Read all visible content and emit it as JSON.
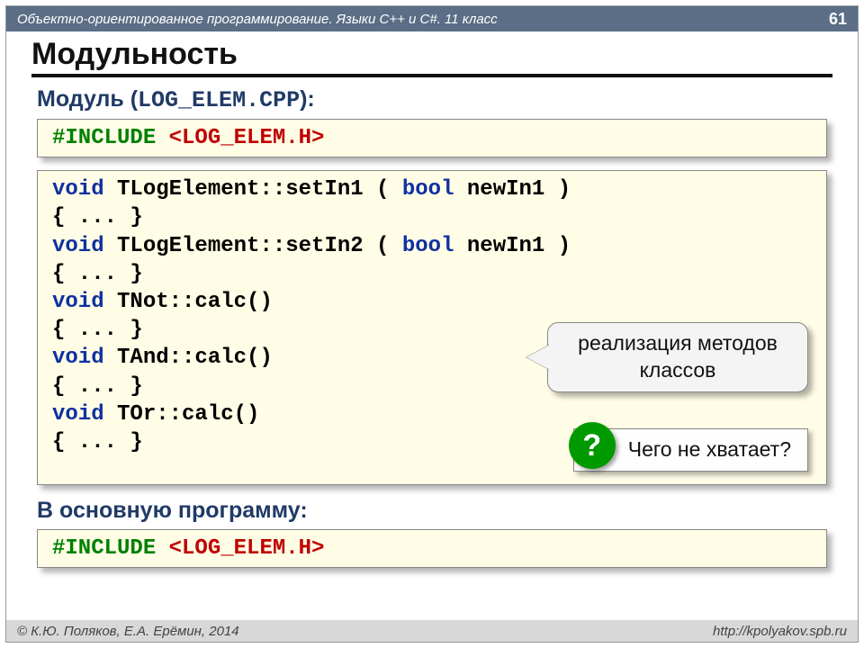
{
  "header": {
    "course": "Объектно-ориентированное программирование. Языки C++ и C#. 11 класс",
    "page": "61"
  },
  "title": "Модульность",
  "module": {
    "label": "Модуль",
    "filename": "LOG_ELEM.CPP",
    "suffix": ":"
  },
  "include1": {
    "directive": "#INCLUDE",
    "file": "<LOG_ELEM.H>"
  },
  "code": {
    "l1a": "void",
    "l1b": " TLogElement::setIn1 ( ",
    "l1c": "bool",
    "l1d": " newIn1 )",
    "l2": "{ ... }",
    "l3a": "void",
    "l3b": " TLogElement::setIn2 ( ",
    "l3c": "bool",
    "l3d": " newIn1 )",
    "l4": "{ ... }",
    "l5a": "void",
    "l5b": " TNot::calc()",
    "l6": "{ ... }",
    "l7a": "void",
    "l7b": " TAnd::calc()",
    "l8": "{ ... }",
    "l9a": "void",
    "l9b": " TOr::calc()",
    "l10": "{ ... }"
  },
  "callout1": "реализация методов классов",
  "question": {
    "mark": "?",
    "text": "Чего не хватает?"
  },
  "mainprog": {
    "label": "В основную программу",
    "suffix": ":"
  },
  "include2": {
    "directive": "#INCLUDE",
    "file": "<LOG_ELEM.H>"
  },
  "footer": {
    "copyright": "© К.Ю. Поляков, Е.А. Ерёмин, 2014",
    "url": "http://kpolyakov.spb.ru"
  }
}
